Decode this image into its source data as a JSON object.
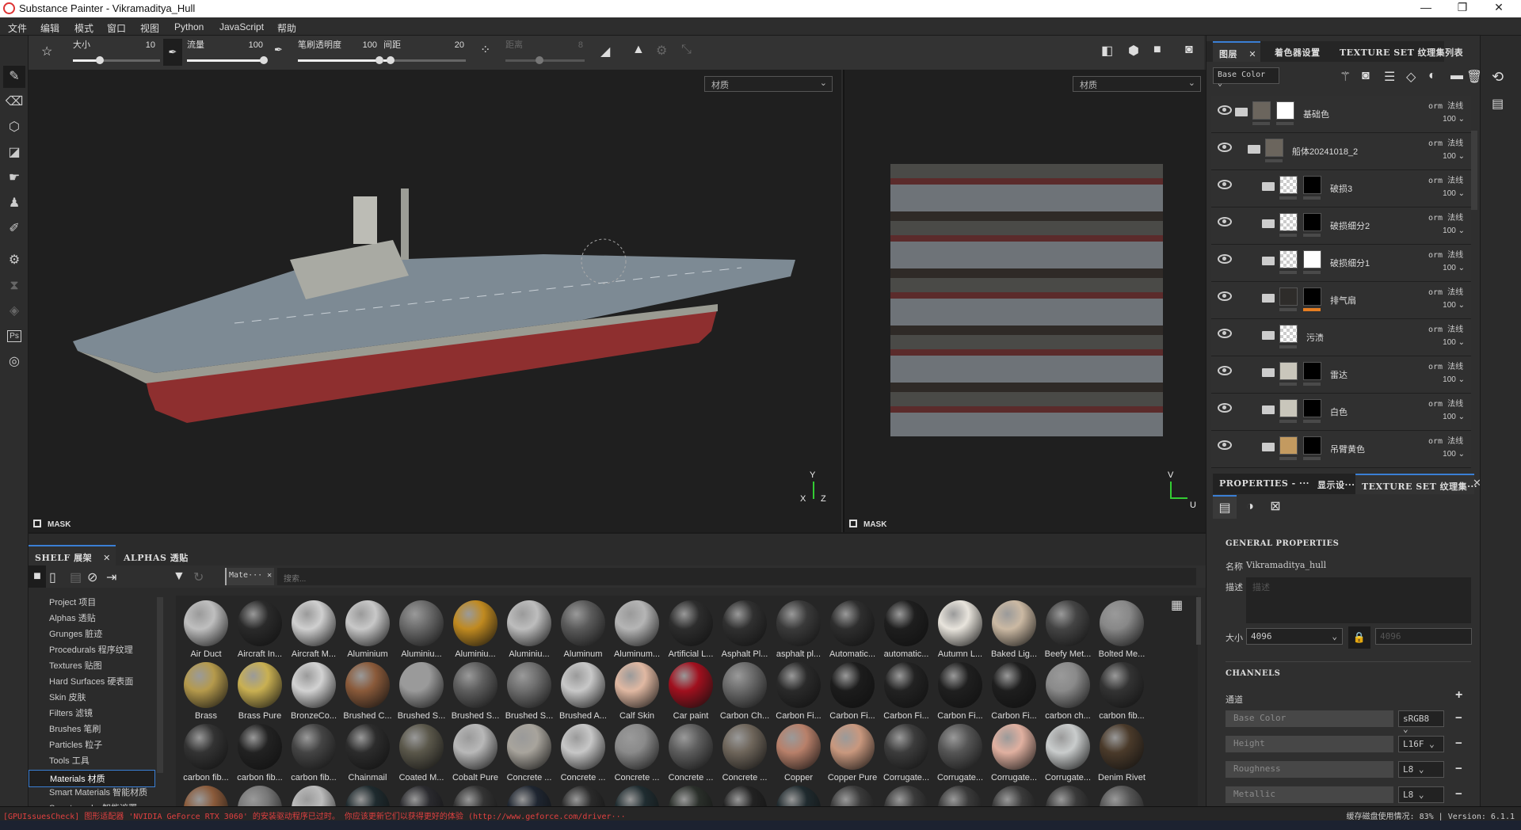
{
  "window": {
    "title": "Substance Painter - Vikramaditya_Hull",
    "minimize": "—",
    "maximize": "❐",
    "close": "✕"
  },
  "menu": [
    "文件",
    "编辑",
    "模式",
    "窗口",
    "视图",
    "Python",
    "JavaScript",
    "帮助"
  ],
  "tool_options": {
    "size_label": "大小",
    "size_value": "10",
    "size_fraction": 0.3,
    "flow_label": "流量",
    "flow_value": "100",
    "flow_fraction": 1.0,
    "opacity_label": "笔刷透明度",
    "opacity_value": "100",
    "opacity_fraction": 1.0,
    "spacing_label": "间距",
    "spacing_value": "20",
    "spacing_fraction": 0.05,
    "distance_label": "距离",
    "distance_value": "8",
    "distance_fraction": 0.4
  },
  "viewport3d": {
    "mode_select": "材质",
    "mask_label": "MASK",
    "axis_y": "Y",
    "axis_x": "X",
    "axis_z": "Z"
  },
  "viewport2d": {
    "mode_select": "材质",
    "mask_label": "MASK",
    "axis_v": "V",
    "axis_u": "U"
  },
  "layers_panel": {
    "tabs": [
      "图层",
      "着色器设置",
      "TEXTURE SET 纹理集列表"
    ],
    "channel_select": "Base Color",
    "layers": [
      {
        "name": "基础色",
        "indent": 0,
        "type": "folder-open",
        "thumb": "#6b655d",
        "mask": "#ffffff",
        "blend": "orm 法线",
        "opacity": "100"
      },
      {
        "name": "船体20241018_2",
        "indent": 1,
        "type": "folder-open",
        "thumb": "#6b655d",
        "mask": null,
        "blend": "orm 法线",
        "opacity": "100"
      },
      {
        "name": "破损3",
        "indent": 2,
        "type": "folder",
        "thumb": "checker",
        "mask": "#000000",
        "blend": "orm 法线",
        "opacity": "100"
      },
      {
        "name": "破损细分2",
        "indent": 2,
        "type": "folder",
        "thumb": "checker",
        "mask": "#000000",
        "blend": "orm 法线",
        "opacity": "100"
      },
      {
        "name": "破损细分1",
        "indent": 2,
        "type": "folder",
        "thumb": "checker",
        "mask": "#ffffff",
        "blend": "orm 法线",
        "opacity": "100"
      },
      {
        "name": "排气扇",
        "indent": 2,
        "type": "folder",
        "thumb": "#2e2c2a",
        "mask": "#000000",
        "mask_bar": "#e67e22",
        "blend": "orm 法线",
        "opacity": "100"
      },
      {
        "name": "污渍",
        "indent": 2,
        "type": "folder",
        "thumb": "checker",
        "mask": null,
        "blend": "orm 法线",
        "opacity": "100"
      },
      {
        "name": "雷达",
        "indent": 2,
        "type": "folder",
        "thumb": "#c9c6bb",
        "mask": "#000000",
        "blend": "orm 法线",
        "opacity": "100"
      },
      {
        "name": "白色",
        "indent": 2,
        "type": "folder",
        "thumb": "#c9c6bb",
        "mask": "#000000",
        "blend": "orm 法线",
        "opacity": "100"
      },
      {
        "name": "吊臂黄色",
        "indent": 2,
        "type": "folder",
        "thumb": "#c39a60",
        "mask": "#000000",
        "blend": "orm 法线",
        "opacity": "100"
      }
    ]
  },
  "properties_panel": {
    "tabs": [
      "PROPERTIES - ···",
      "显示设···",
      "TEXTURE SET 纹理集···"
    ],
    "general_title": "GENERAL PROPERTIES",
    "name_label": "名称",
    "name_value": "Vikramaditya_hull",
    "desc_label": "描述",
    "desc_placeholder": "描述",
    "size_label": "大小",
    "size_value": "4096",
    "size_linked": "4096",
    "channels_title": "CHANNELS",
    "channels_label": "通道",
    "add": "+",
    "channels": [
      {
        "name": "Base Color",
        "format": "sRGB8"
      },
      {
        "name": "Height",
        "format": "L16F"
      },
      {
        "name": "Roughness",
        "format": "L8"
      },
      {
        "name": "Metallic",
        "format": "L8"
      }
    ],
    "remove": "−"
  },
  "shelf": {
    "tabs": [
      "SHELF 展架",
      "ALPHAS 透贴"
    ],
    "filter_chip": "Mate···",
    "search_placeholder": "搜索...",
    "categories": [
      "Project 项目",
      "Alphas 透贴",
      "Grunges 脏迹",
      "Procedurals 程序纹理",
      "Textures 贴图",
      "Hard Surfaces 硬表面",
      "Skin 皮肤",
      "Filters 滤镜",
      "Brushes 笔刷",
      "Particles 粒子",
      "Tools 工具",
      "Materials 材质",
      "Smart Materials 智能材质",
      "Smart masks 智能遮罩"
    ],
    "selected_category": "Materials 材质",
    "materials": [
      {
        "name": "Air Duct",
        "color": "#bfbfbf"
      },
      {
        "name": "Aircraft In...",
        "color": "#2a2a2a"
      },
      {
        "name": "Aircraft M...",
        "color": "#cfcfcf"
      },
      {
        "name": "Aluminium",
        "color": "#c8c8c8"
      },
      {
        "name": "Aluminiu...",
        "color": "#6a6a6a"
      },
      {
        "name": "Aluminiu...",
        "color": "#c08a20"
      },
      {
        "name": "Aluminiu...",
        "color": "#bdbdbd"
      },
      {
        "name": "Aluminum",
        "color": "#5a5a5a"
      },
      {
        "name": "Aluminum...",
        "color": "#b5b5b5"
      },
      {
        "name": "Artificial L...",
        "color": "#2d2d2d"
      },
      {
        "name": "Asphalt Pl...",
        "color": "#303030"
      },
      {
        "name": "asphalt pl...",
        "color": "#3a3a3a"
      },
      {
        "name": "Automatic...",
        "color": "#2e2e2e"
      },
      {
        "name": "automatic...",
        "color": "#1e1e1e"
      },
      {
        "name": "Autumn L...",
        "color": "#e8e4dc"
      },
      {
        "name": "Baked Lig...",
        "color": "#cbb9a3"
      },
      {
        "name": "Beefy Met...",
        "color": "#444"
      },
      {
        "name": "Bolted Me...",
        "color": "#888"
      },
      {
        "name": "Brass",
        "color": "#b59a4c"
      },
      {
        "name": "Brass Pure",
        "color": "#c9b052"
      },
      {
        "name": "BronzeCo...",
        "color": "#d2d2d2"
      },
      {
        "name": "Brushed C...",
        "color": "#8a5a3a"
      },
      {
        "name": "Brushed S...",
        "color": "#9a9a9a"
      },
      {
        "name": "Brushed S...",
        "color": "#5e5e5e"
      },
      {
        "name": "Brushed S...",
        "color": "#6e6e6e"
      },
      {
        "name": "Brushed A...",
        "color": "#c8c8c8"
      },
      {
        "name": "Calf Skin",
        "color": "#e0b8a2"
      },
      {
        "name": "Car paint",
        "color": "#a0101e"
      },
      {
        "name": "Carbon Ch...",
        "color": "#6a6a6a"
      },
      {
        "name": "Carbon Fi...",
        "color": "#2a2a2a"
      },
      {
        "name": "Carbon Fi...",
        "color": "#1c1c1c"
      },
      {
        "name": "Carbon Fi...",
        "color": "#222"
      },
      {
        "name": "Carbon Fi...",
        "color": "#1f1f1f"
      },
      {
        "name": "Carbon Fi...",
        "color": "#1e1e1e"
      },
      {
        "name": "carbon ch...",
        "color": "#8a8a8a"
      },
      {
        "name": "carbon fib...",
        "color": "#333"
      },
      {
        "name": "carbon fib...",
        "color": "#333"
      },
      {
        "name": "carbon fib...",
        "color": "#222"
      },
      {
        "name": "carbon fib...",
        "color": "#444"
      },
      {
        "name": "Chainmail",
        "color": "#2c2c2c"
      },
      {
        "name": "Coated M...",
        "color": "#5a574a"
      },
      {
        "name": "Cobalt Pure",
        "color": "#b8b8b8"
      },
      {
        "name": "Concrete ...",
        "color": "#a8a49c"
      },
      {
        "name": "Concrete ...",
        "color": "#c7c7c7"
      },
      {
        "name": "Concrete ...",
        "color": "#8a8a8a"
      },
      {
        "name": "Concrete ...",
        "color": "#5d5d5d"
      },
      {
        "name": "Concrete ...",
        "color": "#6e655a"
      },
      {
        "name": "Copper",
        "color": "#b8806a"
      },
      {
        "name": "Copper Pure",
        "color": "#c9987e"
      },
      {
        "name": "Corrugate...",
        "color": "#3c3c3c"
      },
      {
        "name": "Corrugate...",
        "color": "#555"
      },
      {
        "name": "Corrugate...",
        "color": "#e0b0a0"
      },
      {
        "name": "Corrugate...",
        "color": "#c9cccc"
      },
      {
        "name": "Denim Rivet",
        "color": "#4a3a2a"
      },
      {
        "name": "",
        "color": "#8a5a3a"
      },
      {
        "name": "",
        "color": "#777"
      },
      {
        "name": "",
        "color": "#bcbcbc"
      },
      {
        "name": "",
        "color": "#1e2a2e"
      },
      {
        "name": "",
        "color": "#2a2a2e"
      },
      {
        "name": "",
        "color": "#333"
      },
      {
        "name": "",
        "color": "#1e2530"
      },
      {
        "name": "",
        "color": "#2a2a2a"
      },
      {
        "name": "",
        "color": "#1f2c30"
      },
      {
        "name": "",
        "color": "#2a2f2a"
      },
      {
        "name": "",
        "color": "#222"
      },
      {
        "name": "",
        "color": "#1f2a2e"
      },
      {
        "name": "",
        "color": "#3a3a3a"
      },
      {
        "name": "",
        "color": "#3a3a3a"
      },
      {
        "name": "",
        "color": "#3a3a3a"
      },
      {
        "name": "",
        "color": "#3a3a3a"
      },
      {
        "name": "",
        "color": "#3a3a3a"
      },
      {
        "name": "",
        "color": "#555"
      }
    ]
  },
  "status": {
    "message": "[GPUIssuesCheck] 图形适配器 'NVIDIA GeForce RTX 3060' 的安装驱动程序已过时。 你应该更新它们以获得更好的体验 (http://www.geforce.com/driver···",
    "cache": "缓存磁盘使用情况:  83% | Version: 6.1.1"
  },
  "colors": {
    "accent": "#3a7fd5",
    "error": "#e04040",
    "hull_red": "#8e2f2f",
    "deck": "#7d8a94"
  }
}
